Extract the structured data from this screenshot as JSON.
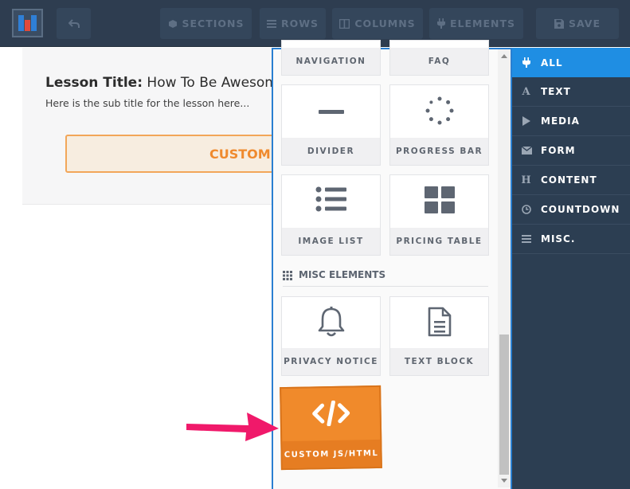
{
  "toolbar": {
    "sections": "SECTIONS",
    "rows": "ROWS",
    "columns": "COLUMNS",
    "elements": "ELEMENTS",
    "save": "SAVE"
  },
  "lesson": {
    "title_label": "Lesson Title:",
    "title_text": "How To Be Awesome",
    "subtitle": "Here is the sub title for the lesson here...",
    "custom_button": "CUSTOM"
  },
  "panel": {
    "tiles_top": [
      {
        "label": "NAVIGATION"
      },
      {
        "label": "FAQ"
      },
      {
        "label": "DIVIDER",
        "icon": "divider-icon"
      },
      {
        "label": "PROGRESS BAR",
        "icon": "progress-spinner-icon"
      },
      {
        "label": "IMAGE LIST",
        "icon": "list-icon"
      },
      {
        "label": "PRICING TABLE",
        "icon": "grid-icon"
      }
    ],
    "misc_heading": "MISC ELEMENTS",
    "misc_tiles": [
      {
        "label": "PRIVACY NOTICE",
        "icon": "bell-icon"
      },
      {
        "label": "TEXT BLOCK",
        "icon": "document-icon"
      },
      {
        "label": "CUSTOM JS/HTML",
        "icon": "code-icon"
      }
    ]
  },
  "categories": [
    {
      "label": "ALL",
      "icon": "plug-icon",
      "active": true
    },
    {
      "label": "TEXT",
      "icon": "text-icon"
    },
    {
      "label": "MEDIA",
      "icon": "play-icon"
    },
    {
      "label": "FORM",
      "icon": "envelope-icon"
    },
    {
      "label": "CONTENT",
      "icon": "heading-icon"
    },
    {
      "label": "COUNTDOWN",
      "icon": "clock-icon"
    },
    {
      "label": "MISC.",
      "icon": "menu-icon"
    }
  ],
  "colors": {
    "toolbar_bg": "#2e3d50",
    "accent_blue": "#1f8ee3",
    "orange": "#f08a2b",
    "arrow_pink": "#f0196a"
  }
}
